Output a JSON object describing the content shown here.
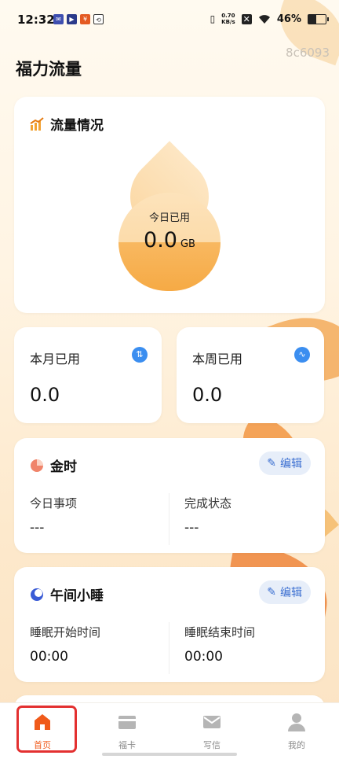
{
  "status_bar": {
    "time": "12:32",
    "speed_value": "0.70",
    "speed_unit": "KB/s",
    "battery": "46%"
  },
  "header": {
    "title": "福力流量",
    "device_id": "8c6093"
  },
  "flow_card": {
    "title": "流量情况",
    "today_label": "今日已用",
    "today_value": "0.0",
    "today_unit": "GB"
  },
  "month_card": {
    "label": "本月已用",
    "value": "0.0"
  },
  "week_card": {
    "label": "本周已用",
    "value": "0.0"
  },
  "gold_card": {
    "title": "金时",
    "edit_label": "编辑",
    "col1_label": "今日事项",
    "col1_value": "---",
    "col2_label": "完成状态",
    "col2_value": "---"
  },
  "nap_card": {
    "title": "午间小睡",
    "edit_label": "编辑",
    "col1_label": "睡眠开始时间",
    "col1_value": "00:00",
    "col2_label": "睡眠结束时间",
    "col2_value": "00:00"
  },
  "bottom_nav": {
    "items": [
      {
        "label": "首页",
        "icon": "home-icon",
        "active": true
      },
      {
        "label": "福卡",
        "icon": "card-icon",
        "active": false
      },
      {
        "label": "写信",
        "icon": "mail-icon",
        "active": false
      },
      {
        "label": "我的",
        "icon": "user-icon",
        "active": false
      }
    ]
  },
  "colors": {
    "accent": "#f05a1a",
    "edit_blue": "#3b6fd1",
    "highlight_box": "#e33030"
  }
}
